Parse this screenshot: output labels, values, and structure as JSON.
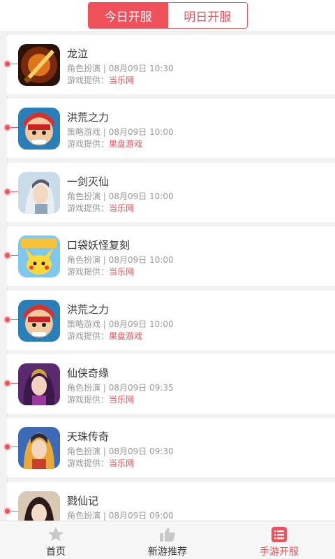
{
  "tabs": [
    {
      "label": "今日开服",
      "active": true
    },
    {
      "label": "明日开服",
      "active": false
    }
  ],
  "provider_prefix": "游戏提供：",
  "games": [
    {
      "name": "龙泣",
      "genre": "角色扮演",
      "time": "08月09日 10:30",
      "provider": "当乐网",
      "icon": "sword-game-icon"
    },
    {
      "name": "洪荒之力",
      "genre": "策略游戏",
      "time": "08月09日 10:00",
      "provider": "果盘游戏",
      "icon": "warrior-game-icon"
    },
    {
      "name": "一剑灭仙",
      "genre": "角色扮演",
      "time": "08月09日 10:00",
      "provider": "当乐网",
      "icon": "swordsman-game-icon"
    },
    {
      "name": "口袋妖怪复刻",
      "genre": "角色扮演",
      "time": "08月09日 10:00",
      "provider": "当乐网",
      "icon": "pikachu-game-icon"
    },
    {
      "name": "洪荒之力",
      "genre": "策略游戏",
      "time": "08月09日 10:00",
      "provider": "果盘游戏",
      "icon": "warrior-game-icon"
    },
    {
      "name": "仙侠奇缘",
      "genre": "角色扮演",
      "time": "08月09日 09:35",
      "provider": "当乐网",
      "icon": "heroine-game-icon"
    },
    {
      "name": "天珠传奇",
      "genre": "角色扮演",
      "time": "08月09日 09:30",
      "provider": "当乐网",
      "icon": "hero-game-icon"
    },
    {
      "name": "戮仙记",
      "genre": "角色扮演",
      "time": "08月09日 09:00",
      "provider": "",
      "icon": "lady-game-icon"
    }
  ],
  "nav": [
    {
      "label": "首页",
      "icon": "star-icon",
      "active": false
    },
    {
      "label": "新游推荐",
      "icon": "thumbs-up-icon",
      "active": false
    },
    {
      "label": "手游开服",
      "icon": "list-icon",
      "active": true
    }
  ],
  "colors": {
    "accent": "#f0505a",
    "text": "#333333",
    "muted": "#999999"
  }
}
